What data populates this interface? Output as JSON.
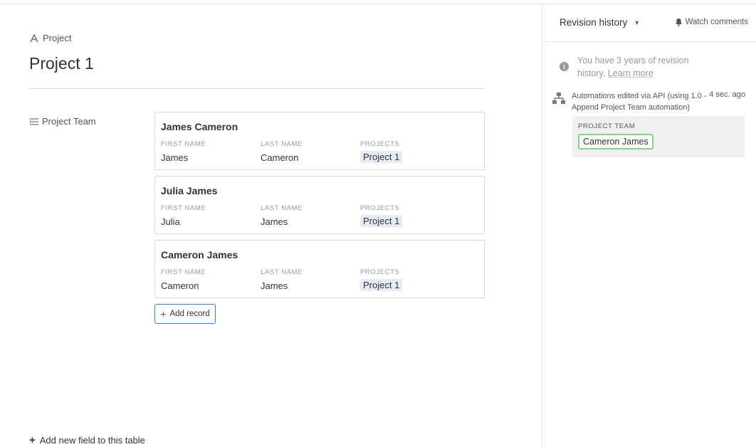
{
  "main": {
    "table_name": "Project",
    "record_title": "Project 1",
    "field_label": "Project Team",
    "column_headers": [
      "FIRST NAME",
      "LAST NAME",
      "PROJECTS"
    ],
    "cards": [
      {
        "title": "James Cameron",
        "first_name": "James",
        "last_name": "Cameron",
        "project": "Project 1"
      },
      {
        "title": "Julia James",
        "first_name": "Julia",
        "last_name": "James",
        "project": "Project 1"
      },
      {
        "title": "Cameron James",
        "first_name": "Cameron",
        "last_name": "James",
        "project": "Project 1"
      }
    ],
    "add_record_label": "Add record",
    "add_field_label": "Add new field to this table"
  },
  "sidebar": {
    "revision_history_label": "Revision history",
    "watch_comments_label": "Watch comments",
    "info_text": "You have 3 years of revision history.",
    "learn_more_label": "Learn more",
    "entry": {
      "description": "Automations edited via API (using 1.0 - Append Project Team automation)",
      "time": "4 sec. ago",
      "field_name": "PROJECT TEAM",
      "added_value": "Cameron James"
    }
  },
  "colors": {
    "accent_blue": "#2d7ff9",
    "chip_bg": "#e6ebf7",
    "added_green": "#7fd77f"
  }
}
